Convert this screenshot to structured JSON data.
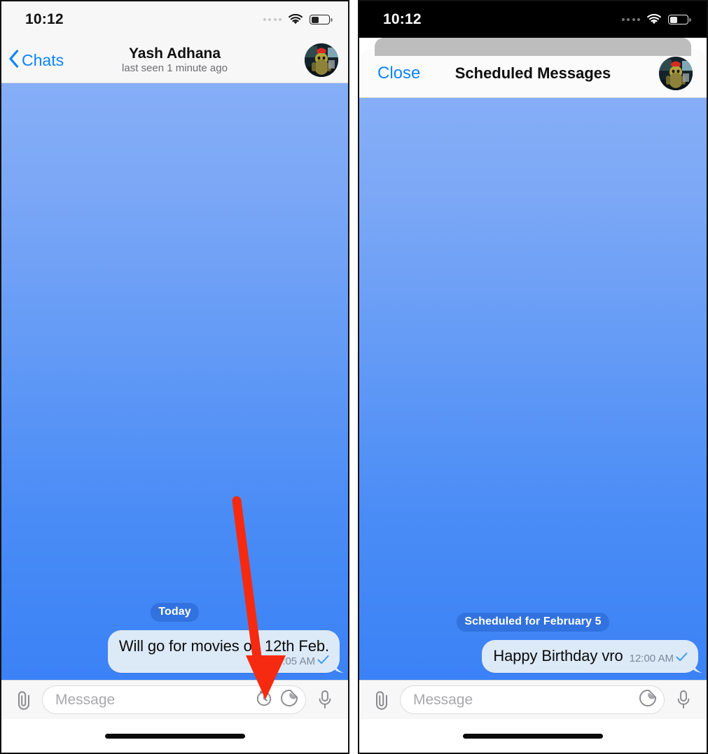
{
  "left_phone": {
    "status_bar": {
      "time": "10:12",
      "wifi_icon": "wifi-icon",
      "battery_icon": "battery-icon",
      "signal_dots_icon": "signal-dots-icon"
    },
    "nav_bar": {
      "back_label": "Chats",
      "back_icon": "chevron-left-icon",
      "title": "Yash Adhana",
      "subtitle": "last seen 1 minute ago",
      "avatar_icon": "contact-avatar"
    },
    "chat": {
      "day_separator": "Today",
      "messages": [
        {
          "text": "Will go for movies on 12th Feb.",
          "time": "10:05 AM",
          "status_icon": "single-check-icon",
          "outgoing": true
        }
      ]
    },
    "input_bar": {
      "attach_icon": "paperclip-icon",
      "placeholder": "Message",
      "schedule_icon": "clock-arrow-icon",
      "sticker_icon": "sticker-icon",
      "mic_icon": "microphone-icon"
    },
    "home_indicator_icon": "home-indicator"
  },
  "right_phone": {
    "status_bar": {
      "time": "10:12",
      "wifi_icon": "wifi-icon",
      "battery_icon": "battery-icon",
      "signal_dots_icon": "signal-dots-icon"
    },
    "modal": {
      "close_label": "Close",
      "title": "Scheduled Messages",
      "avatar_icon": "contact-avatar"
    },
    "chat": {
      "day_separator": "Scheduled for February 5",
      "messages": [
        {
          "text": "Happy Birthday vro",
          "time": "12:00 AM",
          "status_icon": "single-check-icon",
          "outgoing": true
        }
      ]
    },
    "input_bar": {
      "attach_icon": "paperclip-icon",
      "placeholder": "Message",
      "sticker_icon": "sticker-icon",
      "mic_icon": "microphone-icon"
    },
    "home_indicator_icon": "home-indicator"
  },
  "annotation": {
    "arrow_icon": "red-arrow-pointing-to-schedule-icon",
    "color": "#f62a10"
  },
  "colors": {
    "accent_blue": "#0a84ff",
    "chat_gradient_top": "#86aef7",
    "chat_gradient_bottom": "#3b82f6",
    "bubble": "#dce9f7",
    "tick": "#3f9bf0"
  }
}
